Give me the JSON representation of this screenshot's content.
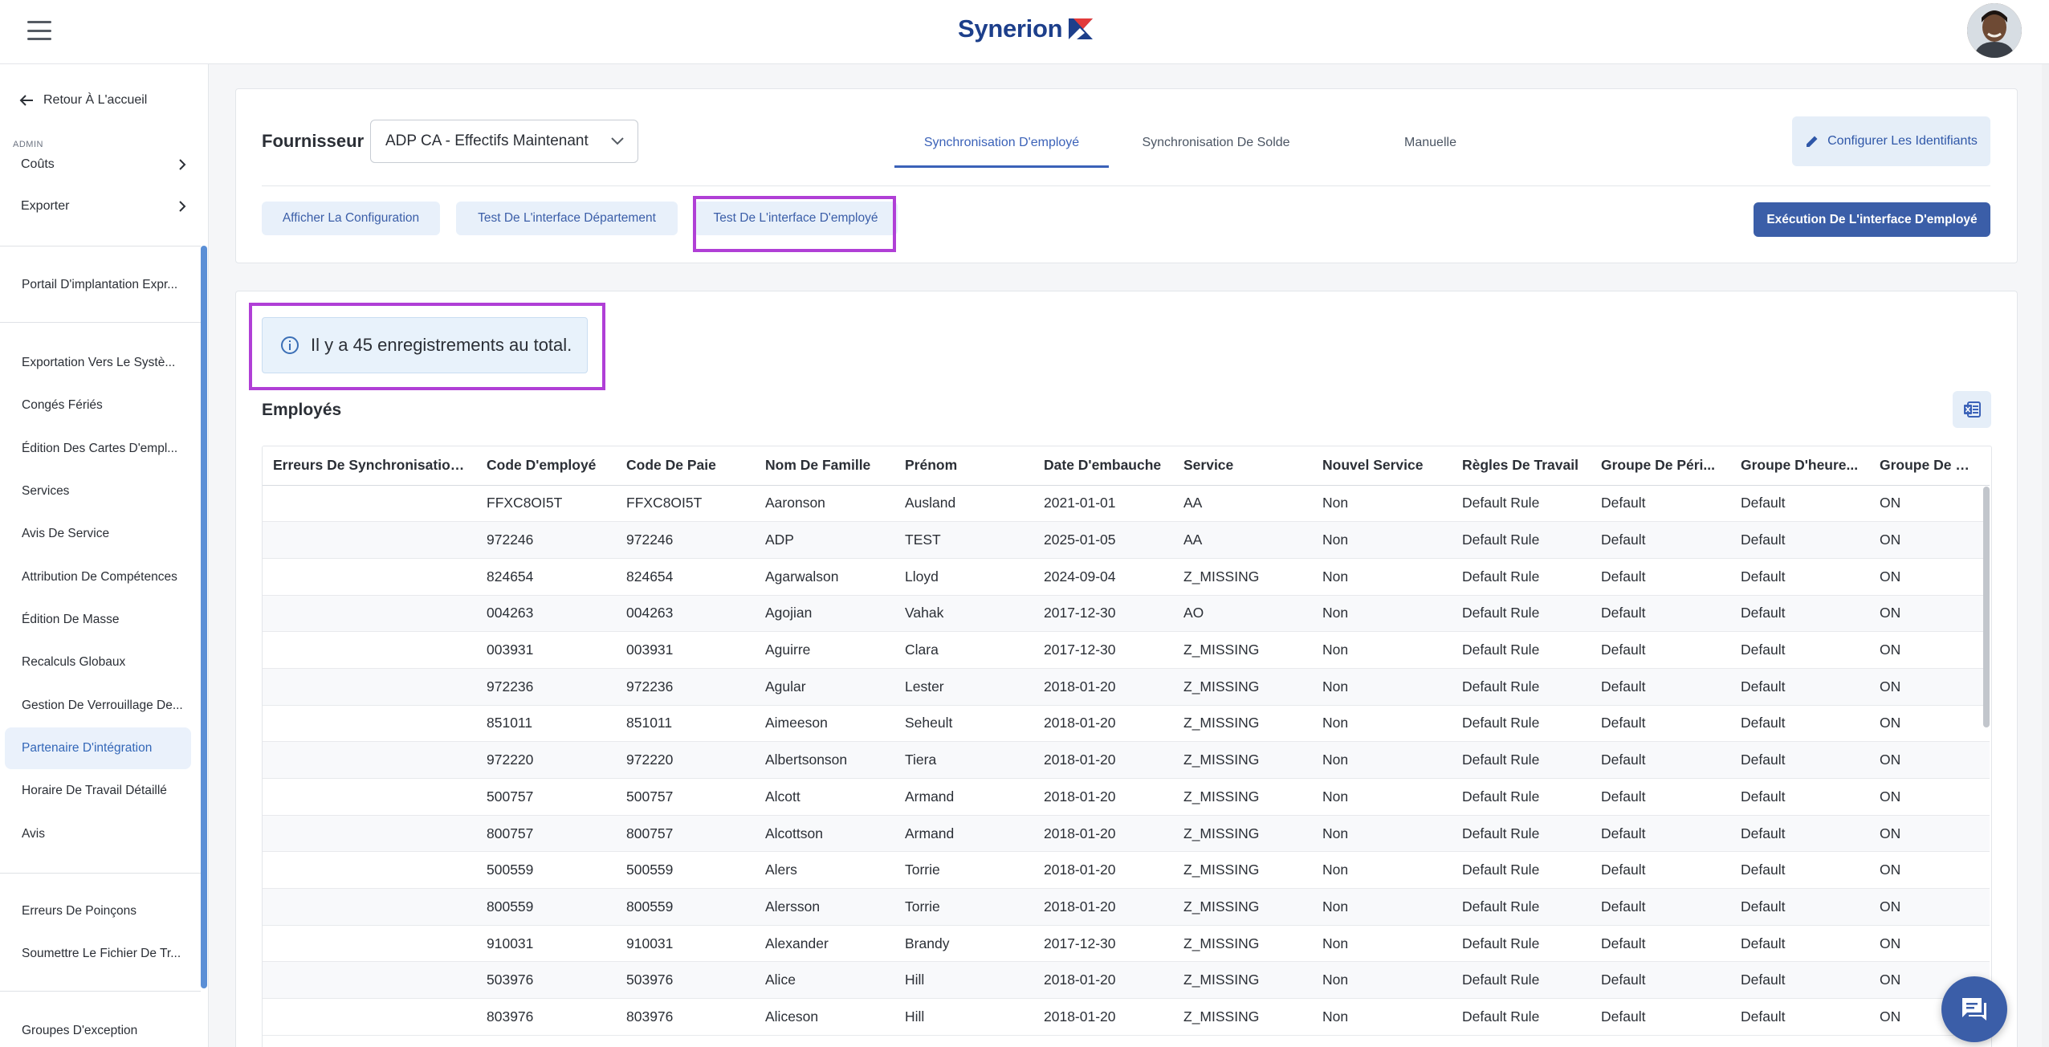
{
  "brand": {
    "name": "Synerion"
  },
  "sidebar": {
    "back_label": "Retour À L'accueil",
    "admin_label": "ADMIN",
    "expand_items": [
      "Coûts",
      "Exporter"
    ],
    "items": [
      "Portail D'implantation Expr...",
      "Exportation Vers Le Systè...",
      "Congés Fériés",
      "Édition Des Cartes D'empl...",
      "Services",
      "Avis De Service",
      "Attribution De Compétences",
      "Édition De Masse",
      "Recalculs Globaux",
      "Gestion De Verrouillage De...",
      "Partenaire D'intégration",
      "Horaire De Travail Détaillé",
      "Avis",
      "Erreurs De Poinçons",
      "Soumettre Le Fichier De Tr...",
      "Groupes D'exception"
    ],
    "active_item": "Partenaire D'intégration"
  },
  "provider": {
    "label": "Fournisseur",
    "selected": "ADP CA - Effectifs Maintenant"
  },
  "tabs": [
    "Synchronisation D'employé",
    "Synchronisation De Solde",
    "Manuelle"
  ],
  "active_tab": "Synchronisation D'employé",
  "configure_button": "Configurer Les Identifiants",
  "sub_buttons": {
    "show_config": "Afficher La Configuration",
    "test_department": "Test De L'interface Département",
    "test_employee": "Test De L'interface D'employé"
  },
  "execute_button": "Exécution De L'interface D'employé",
  "info_message": "Il y a 45 enregistrements au total.",
  "section_title": "Employés",
  "table": {
    "columns": [
      "Erreurs De Synchronisation...",
      "Code D'employé",
      "Code De Paie",
      "Nom De Famille",
      "Prénom",
      "Date D'embauche",
      "Service",
      "Nouvel Service",
      "Règles De Travail",
      "Groupe De Péri...",
      "Groupe D'heure...",
      "Groupe De Con..."
    ],
    "rows": [
      [
        "",
        "FFXC8OI5T",
        "FFXC8OI5T",
        "Aaronson",
        "Ausland",
        "2021-01-01",
        "AA",
        "Non",
        "Default Rule",
        "Default",
        "Default",
        "ON"
      ],
      [
        "",
        "972246",
        "972246",
        "ADP",
        "TEST",
        "2025-01-05",
        "AA",
        "Non",
        "Default Rule",
        "Default",
        "Default",
        "ON"
      ],
      [
        "",
        "824654",
        "824654",
        "Agarwalson",
        "Lloyd",
        "2024-09-04",
        "Z_MISSING",
        "Non",
        "Default Rule",
        "Default",
        "Default",
        "ON"
      ],
      [
        "",
        "004263",
        "004263",
        "Agojian",
        "Vahak",
        "2017-12-30",
        "AO",
        "Non",
        "Default Rule",
        "Default",
        "Default",
        "ON"
      ],
      [
        "",
        "003931",
        "003931",
        "Aguirre",
        "Clara",
        "2017-12-30",
        "Z_MISSING",
        "Non",
        "Default Rule",
        "Default",
        "Default",
        "ON"
      ],
      [
        "",
        "972236",
        "972236",
        "Agular",
        "Lester",
        "2018-01-20",
        "Z_MISSING",
        "Non",
        "Default Rule",
        "Default",
        "Default",
        "ON"
      ],
      [
        "",
        "851011",
        "851011",
        "Aimeeson",
        "Seheult",
        "2018-01-20",
        "Z_MISSING",
        "Non",
        "Default Rule",
        "Default",
        "Default",
        "ON"
      ],
      [
        "",
        "972220",
        "972220",
        "Albertsonson",
        "Tiera",
        "2018-01-20",
        "Z_MISSING",
        "Non",
        "Default Rule",
        "Default",
        "Default",
        "ON"
      ],
      [
        "",
        "500757",
        "500757",
        "Alcott",
        "Armand",
        "2018-01-20",
        "Z_MISSING",
        "Non",
        "Default Rule",
        "Default",
        "Default",
        "ON"
      ],
      [
        "",
        "800757",
        "800757",
        "Alcottson",
        "Armand",
        "2018-01-20",
        "Z_MISSING",
        "Non",
        "Default Rule",
        "Default",
        "Default",
        "ON"
      ],
      [
        "",
        "500559",
        "500559",
        "Alers",
        "Torrie",
        "2018-01-20",
        "Z_MISSING",
        "Non",
        "Default Rule",
        "Default",
        "Default",
        "ON"
      ],
      [
        "",
        "800559",
        "800559",
        "Alersson",
        "Torrie",
        "2018-01-20",
        "Z_MISSING",
        "Non",
        "Default Rule",
        "Default",
        "Default",
        "ON"
      ],
      [
        "",
        "910031",
        "910031",
        "Alexander",
        "Brandy",
        "2017-12-30",
        "Z_MISSING",
        "Non",
        "Default Rule",
        "Default",
        "Default",
        "ON"
      ],
      [
        "",
        "503976",
        "503976",
        "Alice",
        "Hill",
        "2018-01-20",
        "Z_MISSING",
        "Non",
        "Default Rule",
        "Default",
        "Default",
        "ON"
      ],
      [
        "",
        "803976",
        "803976",
        "Aliceson",
        "Hill",
        "2018-01-20",
        "Z_MISSING",
        "Non",
        "Default Rule",
        "Default",
        "Default",
        "ON"
      ]
    ]
  },
  "colors": {
    "primary": "#3b5ea8",
    "brand_text": "#1d3f8b",
    "highlight": "#b03fd6",
    "info_bg": "#e8f2fb"
  }
}
